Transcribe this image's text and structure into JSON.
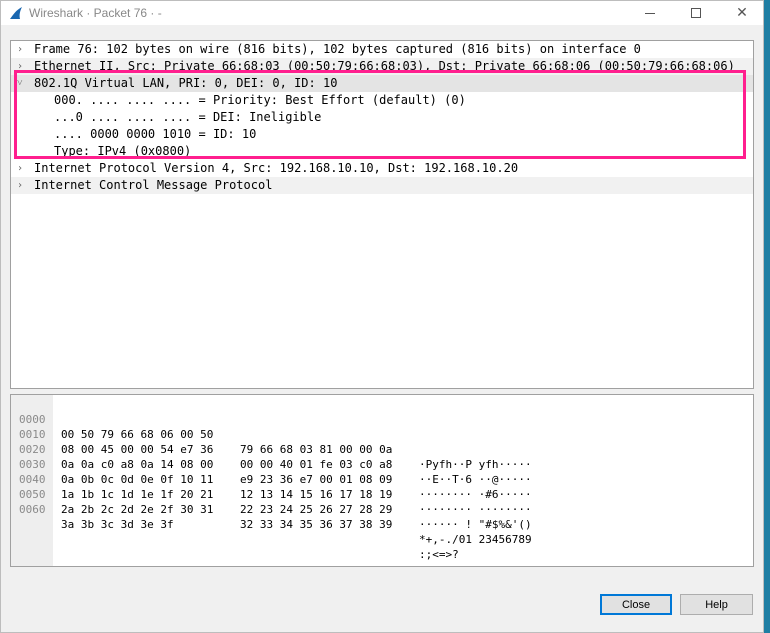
{
  "window": {
    "title": "Wireshark · Packet 76 · -",
    "controls": {
      "minimize": "",
      "maximize": "",
      "close": "✕"
    }
  },
  "tree": {
    "rows": [
      {
        "arrow": "›",
        "text": "Frame 76: 102 bytes on wire (816 bits), 102 bytes captured (816 bits) on interface 0"
      },
      {
        "arrow": "›",
        "text": "Ethernet II, Src: Private_66:68:03 (00:50:79:66:68:03), Dst: Private_66:68:06 (00:50:79:66:68:06)"
      },
      {
        "arrow": "˅",
        "text": "802.1Q Virtual LAN, PRI: 0, DEI: 0, ID: 10"
      },
      {
        "arrow": "",
        "text": "000. .... .... .... = Priority: Best Effort (default) (0)"
      },
      {
        "arrow": "",
        "text": "...0 .... .... .... = DEI: Ineligible"
      },
      {
        "arrow": "",
        "text": ".... 0000 0000 1010 = ID: 10"
      },
      {
        "arrow": "",
        "text": "Type: IPv4 (0x0800)"
      },
      {
        "arrow": "›",
        "text": "Internet Protocol Version 4, Src: 192.168.10.10, Dst: 192.168.10.20"
      },
      {
        "arrow": "›",
        "text": "Internet Control Message Protocol"
      }
    ]
  },
  "hex": {
    "rows": [
      {
        "offset": "0000",
        "hex_left": "00 50 79 66 68 06 00 50",
        "hex_right": "79 66 68 03 81 00 00 0a",
        "ascii": "·Pyfh··P yfh·····"
      },
      {
        "offset": "0010",
        "hex_left": "08 00 45 00 00 54 e7 36",
        "hex_right": "00 00 40 01 fe 03 c0 a8",
        "ascii": "··E··T·6 ··@·····"
      },
      {
        "offset": "0020",
        "hex_left": "0a 0a c0 a8 0a 14 08 00",
        "hex_right": "e9 23 36 e7 00 01 08 09",
        "ascii": "········ ·#6·····"
      },
      {
        "offset": "0030",
        "hex_left": "0a 0b 0c 0d 0e 0f 10 11",
        "hex_right": "12 13 14 15 16 17 18 19",
        "ascii": "········ ········"
      },
      {
        "offset": "0040",
        "hex_left": "1a 1b 1c 1d 1e 1f 20 21",
        "hex_right": "22 23 24 25 26 27 28 29",
        "ascii": "······ ! \"#$%&'()"
      },
      {
        "offset": "0050",
        "hex_left": "2a 2b 2c 2d 2e 2f 30 31",
        "hex_right": "32 33 34 35 36 37 38 39",
        "ascii": "*+,-./01 23456789"
      },
      {
        "offset": "0060",
        "hex_left": "3a 3b 3c 3d 3e 3f",
        "hex_right": "",
        "ascii": ":;<=>?"
      }
    ]
  },
  "buttons": {
    "close": "Close",
    "help": "Help"
  },
  "colors": {
    "highlight": "#ff1f8e",
    "default_button_border": "#0078d7",
    "desktop_edge": "#1f7ea3",
    "app_icon": "#1a67b0"
  }
}
